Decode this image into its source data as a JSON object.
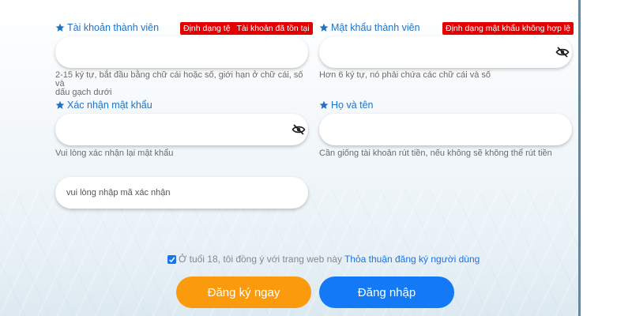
{
  "form": {
    "username": {
      "label": "Tài khoản thành viên",
      "error_prefix": "Định dạng tệ",
      "error_main": "Tài khoản đã tồn tại",
      "value": "",
      "hint_line1": "2-15 ký tự, bắt đầu bằng chữ cái hoặc số, giới hạn ở chữ cái, số và",
      "hint_line2": "dấu gạch dưới"
    },
    "password": {
      "label": "Mật khẩu thành viên",
      "error": "Định dạng mật khẩu không hợp lệ",
      "value": "",
      "hint": "Hơn 6 ký tự, nó phải chứa các chữ cái và số"
    },
    "confirm_password": {
      "label": "Xác nhận mật khẩu",
      "value": "",
      "hint": "Vui lòng xác nhận lại mật khẩu"
    },
    "full_name": {
      "label": "Họ và tên",
      "value": "",
      "hint": "Cần giống tài khoản rút tiền, nếu không sẽ không thể rút tiền"
    },
    "captcha": {
      "placeholder": "vui lòng nhập mã xác nhận",
      "value": ""
    }
  },
  "agreement": {
    "checked": true,
    "text": "Ở tuổi 18, tôi đồng ý với trang web này",
    "link": "Thỏa thuận đăng ký người dùng"
  },
  "buttons": {
    "register": "Đăng ký ngay",
    "login": "Đăng nhập"
  },
  "icons": {
    "required": "star-icon",
    "toggle_password": "eye-off-icon",
    "checkbox": "check-icon"
  },
  "colors": {
    "label": "#1f73c6",
    "error_badge": "#e40000",
    "register_button": "#fb9a0c",
    "login_button": "#1479f5",
    "link": "#1a73e8"
  }
}
